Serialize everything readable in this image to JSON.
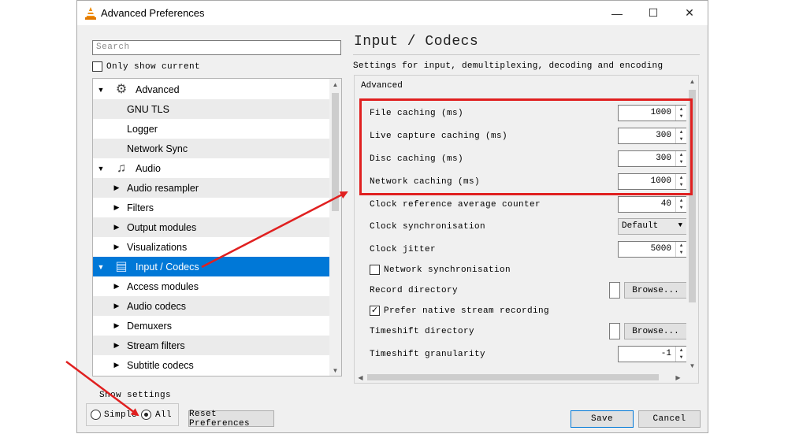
{
  "window": {
    "title": "Advanced Preferences",
    "controls": [
      "—",
      "☐",
      "✕"
    ]
  },
  "sidebar": {
    "search_placeholder": "Search",
    "only_show_current": "Only show current",
    "tree": [
      {
        "label": "Advanced",
        "icon": "chip-icon",
        "arrow": "expanded"
      },
      {
        "label": "GNU TLS"
      },
      {
        "label": "Logger"
      },
      {
        "label": "Network Sync"
      },
      {
        "label": "Audio",
        "icon": "music-note-icon",
        "arrow": "expanded"
      },
      {
        "label": "Audio resampler",
        "arrow": "collapsed"
      },
      {
        "label": "Filters",
        "arrow": "collapsed"
      },
      {
        "label": "Output modules",
        "arrow": "collapsed"
      },
      {
        "label": "Visualizations",
        "arrow": "collapsed"
      },
      {
        "label": "Input / Codecs",
        "icon": "codecs-icon",
        "arrow": "expanded",
        "selected": true
      },
      {
        "label": "Access modules",
        "arrow": "collapsed"
      },
      {
        "label": "Audio codecs",
        "arrow": "collapsed"
      },
      {
        "label": "Demuxers",
        "arrow": "collapsed"
      },
      {
        "label": "Stream filters",
        "arrow": "collapsed"
      },
      {
        "label": "Subtitle codecs",
        "arrow": "collapsed"
      }
    ]
  },
  "show_settings": {
    "label": "Show settings",
    "simple": "Simple",
    "all": "All",
    "selected": "All"
  },
  "buttons": {
    "reset": "Reset Preferences",
    "save": "Save",
    "cancel": "Cancel",
    "browse": "Browse..."
  },
  "panel": {
    "title": "Input / Codecs",
    "subtitle": "Settings for input, demultiplexing, decoding and encoding",
    "group": "Advanced",
    "settings": {
      "file_caching": {
        "label": "File caching (ms)",
        "value": "1000"
      },
      "live_caching": {
        "label": "Live capture caching (ms)",
        "value": "300"
      },
      "disc_caching": {
        "label": "Disc caching (ms)",
        "value": "300"
      },
      "network_caching": {
        "label": "Network caching (ms)",
        "value": "1000"
      },
      "clock_ref": {
        "label": "Clock reference average counter",
        "value": "40"
      },
      "clock_sync": {
        "label": "Clock synchronisation",
        "value": "Default"
      },
      "clock_jitter": {
        "label": "Clock jitter",
        "value": "5000"
      },
      "network_sync": {
        "label": "Network synchronisation",
        "checked": false
      },
      "record_dir": {
        "label": "Record directory"
      },
      "prefer_native": {
        "label": "Prefer native stream recording",
        "checked": true
      },
      "timeshift_dir": {
        "label": "Timeshift directory"
      },
      "timeshift_gran": {
        "label": "Timeshift granularity",
        "value": "-1"
      }
    }
  },
  "colors": {
    "selection": "#0078d7",
    "annotation": "#e02020"
  }
}
